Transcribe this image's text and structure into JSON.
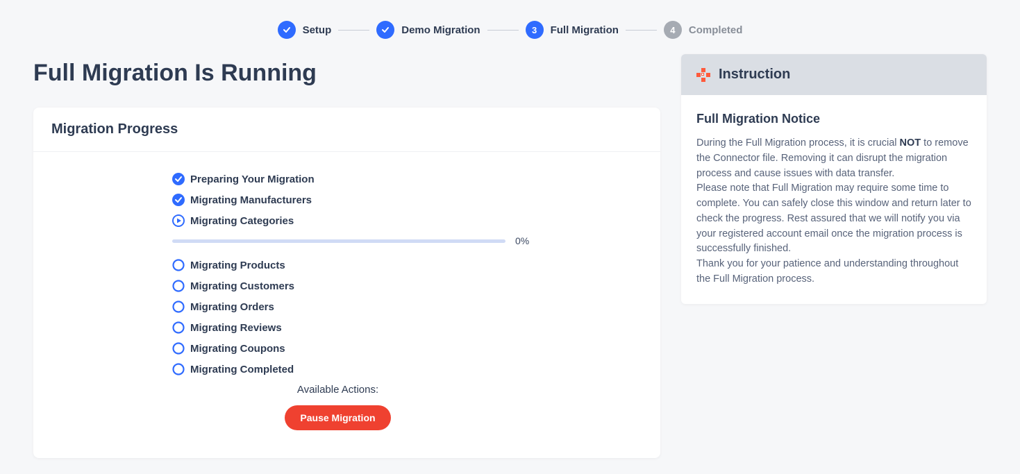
{
  "stepper": {
    "steps": [
      {
        "label": "Setup",
        "status": "completed"
      },
      {
        "label": "Demo Migration",
        "status": "completed"
      },
      {
        "label": "Full Migration",
        "status": "active",
        "num": "3"
      },
      {
        "label": "Completed",
        "status": "upcoming",
        "num": "4"
      }
    ]
  },
  "page_title": "Full Migration Is Running",
  "progress_card": {
    "title": "Migration Progress",
    "tasks": [
      {
        "label": "Preparing Your Migration",
        "state": "done"
      },
      {
        "label": "Migrating Manufacturers",
        "state": "done"
      },
      {
        "label": "Migrating Categories",
        "state": "running",
        "pct": "0%"
      },
      {
        "label": "Migrating Products",
        "state": "pending"
      },
      {
        "label": "Migrating Customers",
        "state": "pending"
      },
      {
        "label": "Migrating Orders",
        "state": "pending"
      },
      {
        "label": "Migrating Reviews",
        "state": "pending"
      },
      {
        "label": "Migrating Coupons",
        "state": "pending"
      },
      {
        "label": "Migrating Completed",
        "state": "pending"
      }
    ],
    "actions_label": "Available Actions:",
    "pause_label": "Pause Migration"
  },
  "instruction": {
    "heading": "Instruction",
    "subheading": "Full Migration Notice",
    "p1a": "During the Full Migration process, it is crucial ",
    "p1b": "NOT",
    "p1c": " to remove the Connector file. Removing it can disrupt the migration process and cause issues with data transfer.",
    "p2": "Please note that Full Migration may require some time to complete. You can safely close this window and return later to check the progress. Rest assured that we will notify you via your registered account email once the migration process is successfully finished.",
    "p3": "Thank you for your patience and understanding throughout the Full Migration process."
  }
}
